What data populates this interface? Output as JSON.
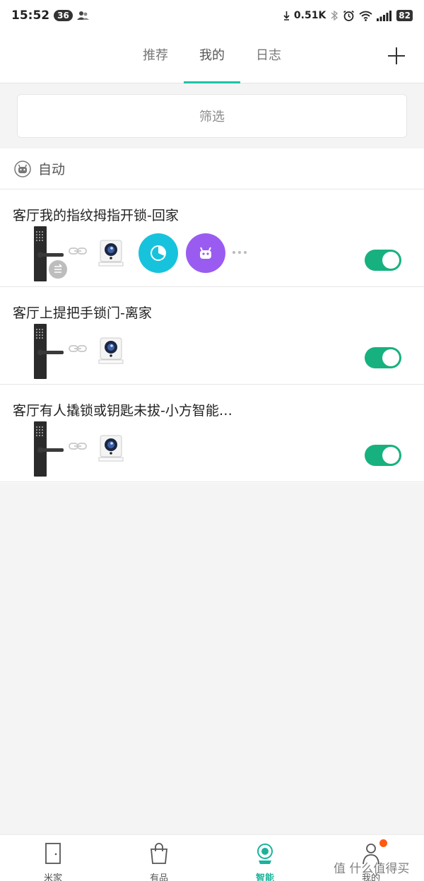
{
  "status_bar": {
    "time": "15:52",
    "notification_count": "36",
    "net_speed": "0.51K",
    "battery": "82"
  },
  "header": {
    "tabs": [
      {
        "label": "推荐"
      },
      {
        "label": "我的"
      },
      {
        "label": "日志"
      }
    ],
    "active_tab": "我的"
  },
  "filter": {
    "label": "筛选"
  },
  "section": {
    "title": "自动",
    "scenes": [
      {
        "title": "客厅我的指纹拇指开锁-回家",
        "enabled": true
      },
      {
        "title": "客厅上提把手锁门-离家",
        "enabled": true
      },
      {
        "title": "客厅有人撬锁或钥匙未拔-小方智能…",
        "enabled": true
      }
    ]
  },
  "bottom_nav": {
    "items": [
      {
        "label": "米家"
      },
      {
        "label": "有品"
      },
      {
        "label": "智能"
      },
      {
        "label": "我的"
      }
    ],
    "active": "智能"
  },
  "watermark": "值 什么值得买",
  "colors": {
    "accent": "#1ec1a8",
    "toggle_on": "#17b17f",
    "cyan": "#17c3dc",
    "purple": "#9a5cf0",
    "badge": "#ff5a13"
  }
}
